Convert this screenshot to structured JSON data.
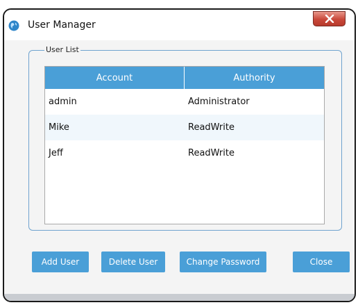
{
  "window": {
    "title": "User Manager"
  },
  "group": {
    "legend": "User List"
  },
  "table": {
    "columns": [
      "Account",
      "Authority"
    ],
    "rows": [
      {
        "account": "admin",
        "authority": "Administrator"
      },
      {
        "account": "Mike",
        "authority": "ReadWrite"
      },
      {
        "account": "Jeff",
        "authority": "ReadWrite"
      }
    ]
  },
  "buttons": {
    "add_user": "Add User",
    "delete_user": "Delete User",
    "change_password": "Change Password",
    "close": "Close"
  },
  "colors": {
    "accent": "#4a9fd7",
    "group_border": "#6fa3cf",
    "close_red": "#c9483a"
  },
  "icons": {
    "app": "globe-icon",
    "close": "close-icon"
  }
}
